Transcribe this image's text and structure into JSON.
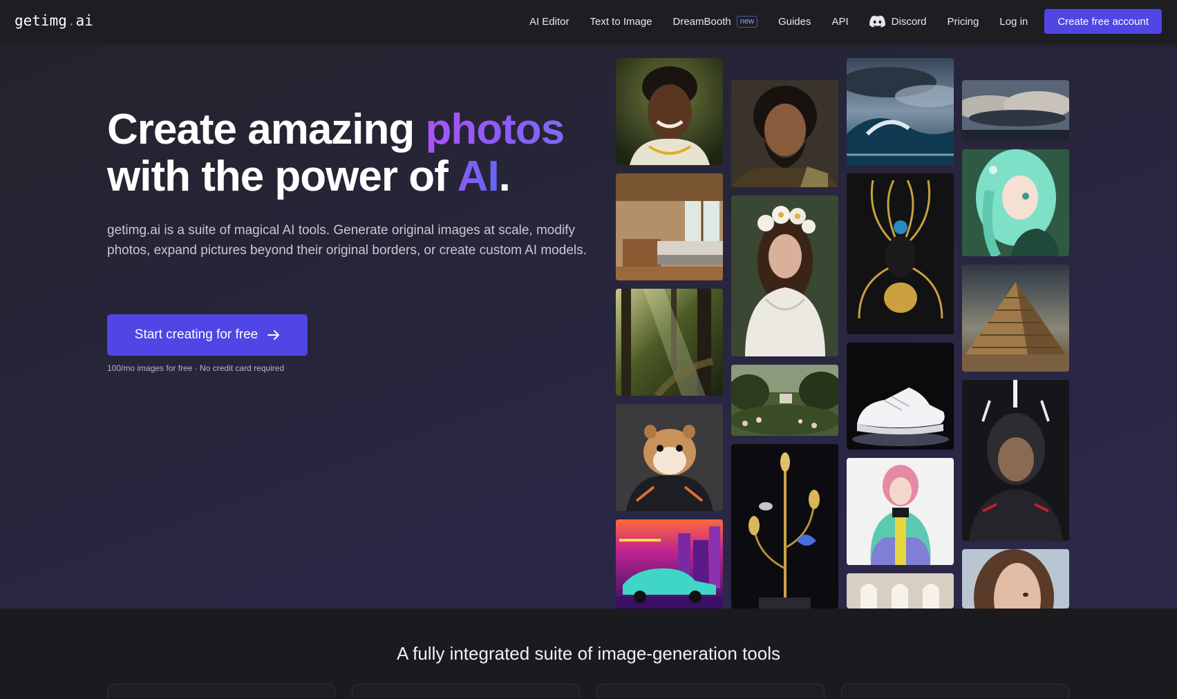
{
  "header": {
    "logo_left": "getimg",
    "logo_dot": ".",
    "logo_right": "ai",
    "nav": {
      "ai_editor": "AI Editor",
      "text_to_image": "Text to Image",
      "dreambooth": "DreamBooth",
      "dreambooth_badge": "new",
      "guides": "Guides",
      "api": "API",
      "discord": "Discord",
      "pricing": "Pricing",
      "login": "Log in",
      "create_account": "Create free account"
    }
  },
  "hero": {
    "title_part1": "Create amazing ",
    "title_accent1": "photos",
    "title_part2": "with the power of ",
    "title_accent2": "AI",
    "title_end": ".",
    "description": "getimg.ai is a suite of magical AI tools. Generate original images at scale, modify photos, expand pictures beyond their original borders, or create custom AI models.",
    "cta_label": "Start creating for free",
    "note": "100/mo images for free · No credit card required"
  },
  "gallery": [
    {
      "name": "portrait-smiling-man-image",
      "caption": "smiling man portrait"
    },
    {
      "name": "bedroom-interior-image",
      "caption": "bedroom interior"
    },
    {
      "name": "forest-light-image",
      "caption": "forest with sunbeams"
    },
    {
      "name": "hamster-astronaut-image",
      "caption": "hamster in jacket"
    },
    {
      "name": "synthwave-car-image",
      "caption": "neon car"
    },
    {
      "name": "bearded-warrior-image",
      "caption": "bearded man"
    },
    {
      "name": "flower-crown-woman-image",
      "caption": "woman with flower crown"
    },
    {
      "name": "garden-landscape-image",
      "caption": "garden"
    },
    {
      "name": "golden-plant-sculpture-image",
      "caption": "golden plant sculpture"
    },
    {
      "name": "stormy-ocean-image",
      "caption": "stormy ocean"
    },
    {
      "name": "golden-mask-figure-image",
      "caption": "golden ornate figure"
    },
    {
      "name": "white-sneaker-image",
      "caption": "white sneaker"
    },
    {
      "name": "pink-hair-girl-3d-image",
      "caption": "pink-haired figure in puffer jacket"
    },
    {
      "name": "arched-windows-interior-image",
      "caption": "arched windows"
    },
    {
      "name": "cloudy-sky-image",
      "caption": "cloudy sky"
    },
    {
      "name": "anime-teal-hair-image",
      "caption": "anime girl with teal hair"
    },
    {
      "name": "pyramid-image",
      "caption": "stepped pyramid"
    },
    {
      "name": "cyber-warrior-image",
      "caption": "armored warrior"
    },
    {
      "name": "woman-portrait-image",
      "caption": "woman portrait"
    }
  ],
  "section2": {
    "title": "A fully integrated suite of image-generation tools"
  },
  "colors": {
    "accent": "#4f46e5",
    "gradient_purple": "#a855f7",
    "gradient_indigo": "#6366f1",
    "logo_dot": "#ef4444"
  }
}
